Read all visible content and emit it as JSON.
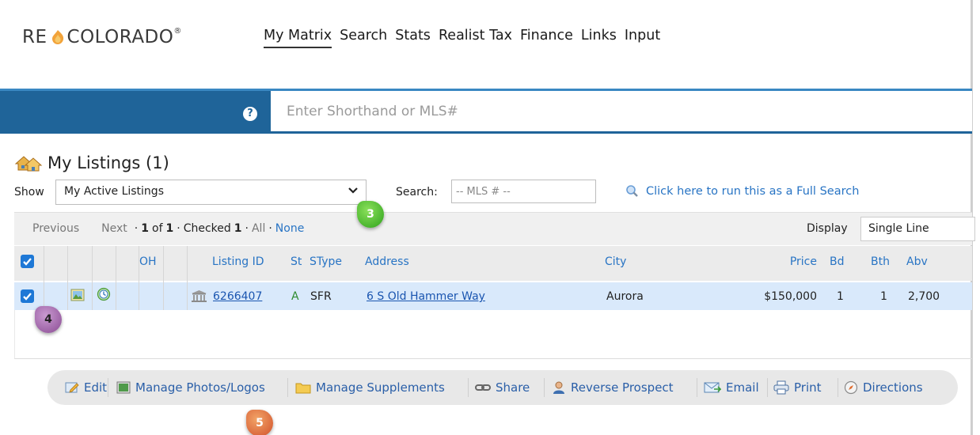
{
  "header": {
    "logo_left": "RE",
    "logo_right": "COLORADO",
    "logo_reg": "®",
    "nav": [
      "My Matrix",
      "Search",
      "Stats",
      "Realist Tax",
      "Finance",
      "Links",
      "Input"
    ]
  },
  "searchbar": {
    "help_glyph": "?",
    "placeholder": "Enter Shorthand or MLS#"
  },
  "page": {
    "title": "My Listings (1)",
    "show_label": "Show",
    "show_value": "My Active Listings",
    "search_label": "Search:",
    "mls_placeholder": "-- MLS # --",
    "full_search_link": "Click here to run this as a Full Search"
  },
  "pager": {
    "previous": "Previous",
    "next": "Next",
    "sep1": "·",
    "page_current": "1",
    "of_word": "of",
    "page_total": "1",
    "sep2": "·",
    "checked_word": "Checked",
    "checked_count": "1",
    "sep3": "·",
    "all": "All",
    "sep4": "·",
    "none": "None",
    "display_label": "Display",
    "display_value": "Single Line"
  },
  "table": {
    "headers": {
      "oh": "OH",
      "listing_id": "Listing ID",
      "st": "St",
      "stype": "SType",
      "address": "Address",
      "city": "City",
      "price": "Price",
      "bd": "Bd",
      "bth": "Bth",
      "abv": "Abv"
    },
    "rows": [
      {
        "checked": true,
        "listing_id": "6266407",
        "st": "A",
        "stype": "SFR",
        "address": "6 S Old Hammer Way",
        "city": "Aurora",
        "price": "$150,000",
        "bd": "1",
        "bth": "1",
        "abv": "2,700"
      }
    ]
  },
  "toolbar": {
    "edit": "Edit",
    "manage_photos": "Manage Photos/Logos",
    "manage_supplements": "Manage Supplements",
    "share": "Share",
    "reverse_prospect": "Reverse Prospect",
    "email": "Email",
    "print": "Print",
    "directions": "Directions"
  },
  "callouts": {
    "three": "3",
    "four": "4",
    "five": "5"
  },
  "colors": {
    "bluebar": "#1f6499",
    "link": "#2874c4",
    "selected_row": "#d9e9fb",
    "checkbox": "#1e78d6",
    "status_active": "#2e8b2e"
  }
}
